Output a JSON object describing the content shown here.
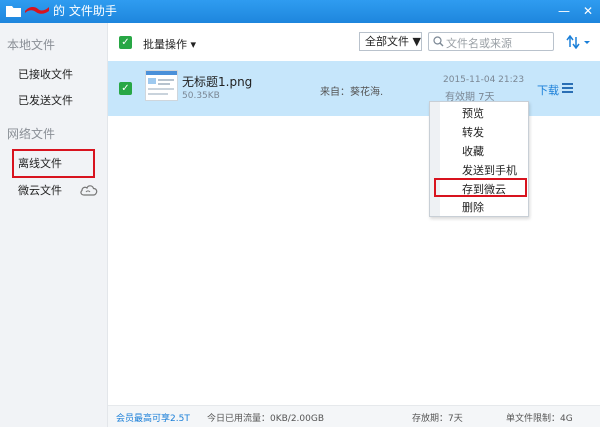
{
  "window": {
    "title": "的 文件助手",
    "minimize_label": "—",
    "close_label": "✕",
    "colors": {
      "titlebar": "#1e86dd",
      "accent": "#1a7fd8",
      "highlight": "#d8131e",
      "selected_row": "#c6e6fb"
    }
  },
  "sidebar": {
    "local_heading": "本地文件",
    "received_label": "已接收文件",
    "sent_label": "已发送文件",
    "network_heading": "网络文件",
    "offline_label": "离线文件",
    "weiyun_label": "微云文件"
  },
  "toolbar": {
    "check_mark": "✓",
    "batch_label": "批量操作 ▾",
    "filter_value": "全部文件 ▼",
    "search_placeholder": "文件名或来源"
  },
  "file": {
    "name": "无标题1.png",
    "size": "50.35KB",
    "source": "来自：葵花海.",
    "date": "2015-11-04 21:23",
    "expiry": "有效期 7天",
    "download_label": "下载"
  },
  "context_menu": {
    "items": [
      "预览",
      "转发",
      "收藏",
      "发送到手机",
      "存到微云",
      "删除"
    ]
  },
  "statusbar": {
    "vip_text": "会员最高可享2.5T",
    "traffic_text": "今日已用流量：0KB/2.00GB",
    "retention_text": "存放期：7天",
    "limit_text": "单文件限制：4G"
  },
  "icons": [
    "folder-icon",
    "minimize-icon",
    "close-icon",
    "cloud-icon",
    "checkbox-icon",
    "search-icon",
    "sort-icon",
    "menu-icon",
    "file-thumbnail"
  ]
}
